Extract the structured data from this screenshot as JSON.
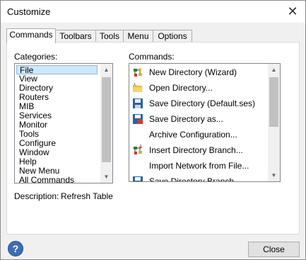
{
  "window": {
    "title": "Customize",
    "close_glyph": "✕"
  },
  "tabs": [
    {
      "label": "Commands"
    },
    {
      "label": "Toolbars"
    },
    {
      "label": "Tools"
    },
    {
      "label": "Menu"
    },
    {
      "label": "Options"
    }
  ],
  "categories": {
    "label": "Categories:",
    "items": [
      "File",
      "View",
      "Directory",
      "Routers",
      "MIB",
      "Services",
      "Monitor",
      "Tools",
      "Configure",
      "Window",
      "Help",
      "New Menu",
      "All Commands"
    ],
    "selected": "File"
  },
  "commands": {
    "label": "Commands:",
    "items": [
      {
        "label": "New Directory (Wizard)",
        "icon": "new-directory-icon"
      },
      {
        "label": "Open Directory...",
        "icon": "open-folder-icon"
      },
      {
        "label": "Save Directory (Default.ses)",
        "icon": "floppy-disk-icon"
      },
      {
        "label": "Save Directory as...",
        "icon": "floppy-disk-edit-icon"
      },
      {
        "label": "Archive Configuration...",
        "icon": ""
      },
      {
        "label": "Insert Directory Branch...",
        "icon": "insert-branch-icon"
      },
      {
        "label": "Import Network from File...",
        "icon": ""
      },
      {
        "label": "Save Directory Branch...",
        "icon": "save-branch-icon"
      }
    ]
  },
  "description": {
    "label": "Description:",
    "value": "Refresh Table"
  },
  "buttons": {
    "help": "?",
    "close": "Close"
  },
  "scroll_arrows": {
    "up": "▲",
    "down": "▼"
  },
  "colors": {
    "selection": "#cce8ff",
    "help_button": "#3c6eb4"
  }
}
